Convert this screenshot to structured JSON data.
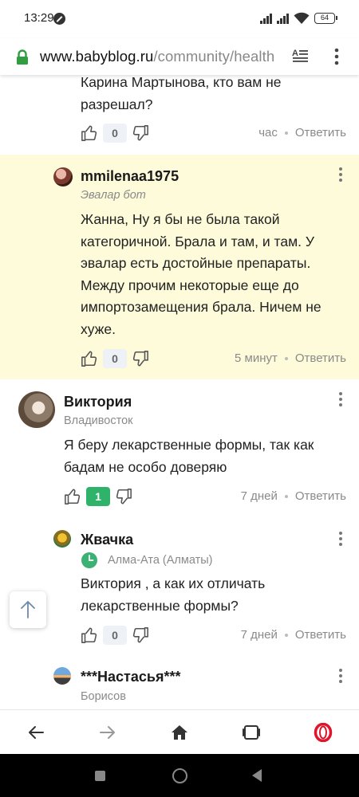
{
  "status_bar": {
    "time": "13:29",
    "battery": "64"
  },
  "browser": {
    "url_host": "www.babyblog.ru",
    "url_path": "/community/health"
  },
  "comments": [
    {
      "text_lines": [
        "Карина Мартынова, кто вам не",
        "разрешал?"
      ],
      "votes": "0",
      "time": "час",
      "reply": "Ответить"
    },
    {
      "author": "mmilenaa1975",
      "subtitle": "Эвалар бот",
      "text_lines": [
        "Жанна, Ну я бы не была такой",
        "категоричной. Брала и там, и там. У",
        "эвалар есть достойные препараты.",
        "Между прочим некоторые еще до",
        "импортозамещения брала. Ничем не",
        "хуже."
      ],
      "votes": "0",
      "time": "5 минут",
      "reply": "Ответить",
      "highlight_color": "#fdfbd9"
    },
    {
      "author": "Виктория",
      "subtitle": "Владивосток",
      "text_lines": [
        "Я беру лекарственные формы, так как",
        "бадам не особо доверяю"
      ],
      "votes": "1",
      "time": "7 дней",
      "reply": "Ответить"
    },
    {
      "author": "Жвачка",
      "subtitle": "Алма-Ата (Алматы)",
      "text_lines": [
        "Виктория , а как их отличать",
        "лекарственные формы?"
      ],
      "votes": "0",
      "time": "7 дней",
      "reply": "Ответить"
    },
    {
      "author": "***Настасья***",
      "subtitle": "Борисов"
    }
  ],
  "icons": {
    "lock": "lock-icon",
    "reader": "reader-mode-icon",
    "menu": "menu-dots-icon",
    "thumb_up": "thumb-up-icon",
    "thumb_down": "thumb-down-icon",
    "scroll_top": "arrow-up-icon",
    "nav_back": "arrow-left-icon",
    "nav_forward": "arrow-right-icon",
    "nav_home": "home-icon",
    "nav_tabs": "tabs-icon",
    "nav_opera": "opera-logo-icon"
  },
  "colors": {
    "accent_green": "#2fb36b",
    "highlight": "#fdfbd9",
    "lock_green": "#2e9e3e",
    "opera_red": "#e0142b"
  }
}
